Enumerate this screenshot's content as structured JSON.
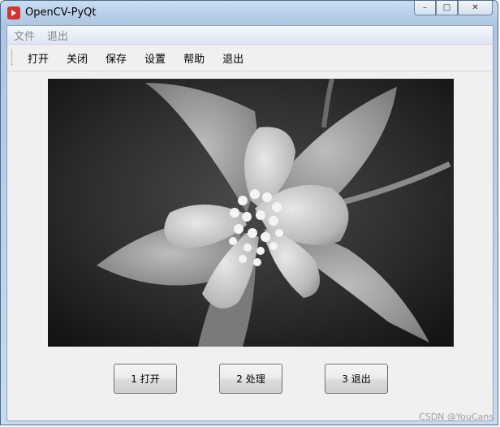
{
  "window": {
    "title": "OpenCV-PyQt",
    "controls": {
      "minimize": "▭",
      "maximize": "□",
      "close": "✕"
    }
  },
  "menubar": {
    "items": [
      {
        "label": "文件"
      },
      {
        "label": "退出"
      }
    ]
  },
  "toolbar": {
    "items": [
      {
        "label": "打开"
      },
      {
        "label": "关闭"
      },
      {
        "label": "保存"
      },
      {
        "label": "设置"
      },
      {
        "label": "帮助"
      },
      {
        "label": "退出"
      }
    ]
  },
  "image": {
    "description_icon": "image-icon"
  },
  "buttons": [
    {
      "label": "1 打开"
    },
    {
      "label": "2 处理"
    },
    {
      "label": "3 退出"
    }
  ],
  "watermark": "CSDN @YouCans"
}
